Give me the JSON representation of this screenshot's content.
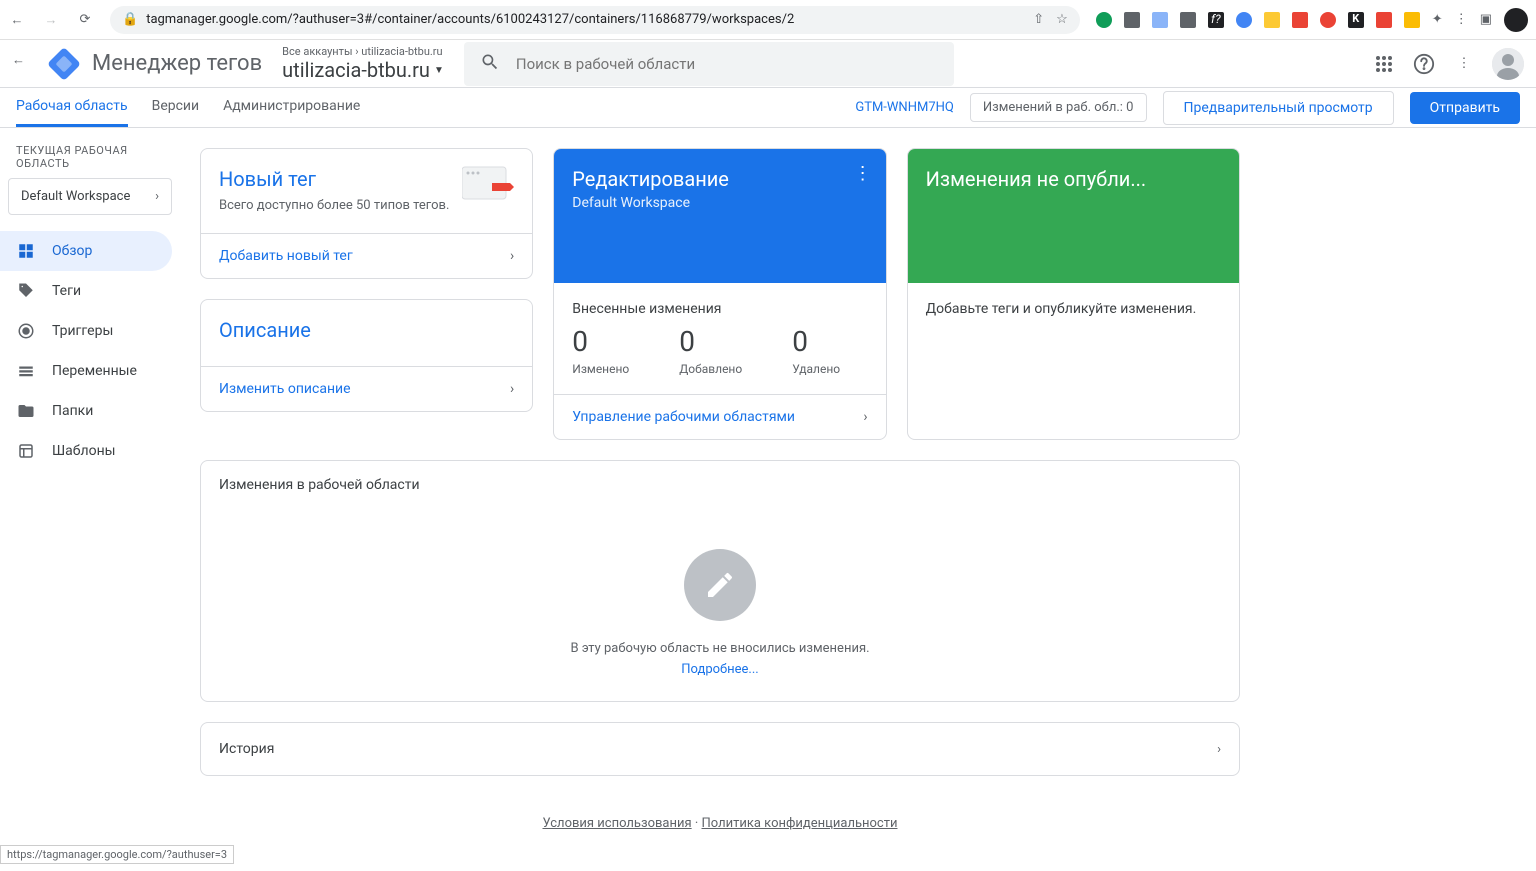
{
  "browser": {
    "url": "tagmanager.google.com/?authuser=3#/container/accounts/6100243127/containers/116868779/workspaces/2",
    "status_url": "https://tagmanager.google.com/?authuser=3"
  },
  "header": {
    "product": "Менеджер тегов",
    "breadcrumb_all": "Все аккаунты",
    "breadcrumb_account": "utilizacia-btbu.ru",
    "breadcrumb_main": "utilizacia-btbu.ru",
    "search_placeholder": "Поиск в рабочей области"
  },
  "tabs": {
    "workspace": "Рабочая область",
    "versions": "Версии",
    "admin": "Администрирование"
  },
  "topright": {
    "gtm_id": "GTM-WNHM7HQ",
    "changes": "Изменений в раб. обл.: 0",
    "preview": "Предварительный просмотр",
    "submit": "Отправить"
  },
  "sidebar": {
    "section_label": "ТЕКУЩАЯ РАБОЧАЯ ОБЛАСТЬ",
    "workspace_name": "Default Workspace",
    "items": [
      {
        "label": "Обзор"
      },
      {
        "label": "Теги"
      },
      {
        "label": "Триггеры"
      },
      {
        "label": "Переменные"
      },
      {
        "label": "Папки"
      },
      {
        "label": "Шаблоны"
      }
    ]
  },
  "cards": {
    "new_tag": {
      "title": "Новый тег",
      "subtitle": "Всего доступно более 50 типов тегов.",
      "action": "Добавить новый тег"
    },
    "description": {
      "title": "Описание",
      "action": "Изменить описание"
    },
    "editing": {
      "title": "Редактирование",
      "subtitle": "Default Workspace",
      "body_title": "Внесенные изменения",
      "stats": [
        {
          "value": "0",
          "label": "Изменено"
        },
        {
          "value": "0",
          "label": "Добавлено"
        },
        {
          "value": "0",
          "label": "Удалено"
        }
      ],
      "action": "Управление рабочими областями"
    },
    "published": {
      "title": "Изменения не опубли...",
      "body_text": "Добавьте теги и опубликуйте изменения."
    }
  },
  "workspace_changes": {
    "title": "Изменения в рабочей области",
    "empty_text": "В эту рабочую область не вносились изменения.",
    "learn_more": "Подробнее..."
  },
  "history": {
    "title": "История"
  },
  "footer": {
    "terms": "Условия использования",
    "privacy": "Политика конфиденциальности"
  }
}
